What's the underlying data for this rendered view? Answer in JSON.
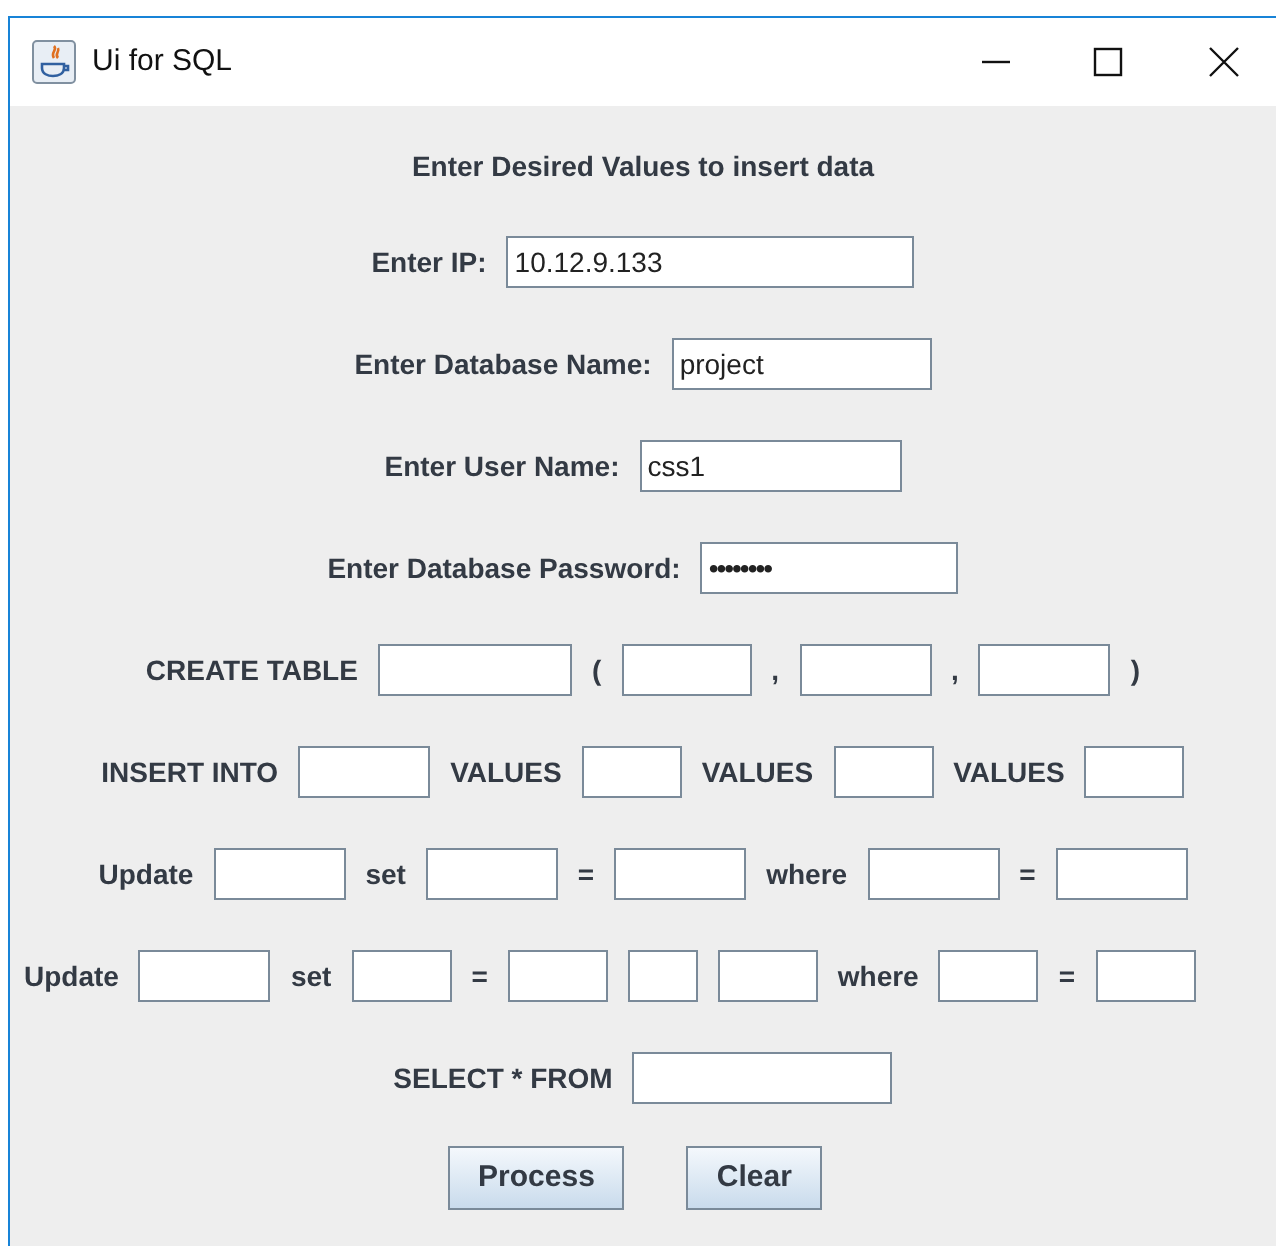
{
  "window": {
    "title": "Ui for SQL"
  },
  "heading": "Enter Desired Values to insert data",
  "rows": [
    {
      "items": [
        {
          "kind": "label",
          "text": "Enter IP:"
        },
        {
          "kind": "field",
          "value": "10.12.9.133"
        }
      ]
    },
    {
      "items": [
        {
          "kind": "label",
          "text": "Enter Database Name:"
        },
        {
          "kind": "field",
          "value": "project"
        }
      ]
    },
    {
      "items": [
        {
          "kind": "label",
          "text": "Enter User Name:"
        },
        {
          "kind": "field",
          "value": "css1"
        }
      ]
    },
    {
      "items": [
        {
          "kind": "label",
          "text": "Enter Database Password:"
        },
        {
          "kind": "password",
          "value": "••••••••"
        }
      ]
    },
    {
      "items": [
        {
          "kind": "label",
          "text": "CREATE TABLE"
        },
        {
          "kind": "field"
        },
        {
          "kind": "label",
          "text": "("
        },
        {
          "kind": "field"
        },
        {
          "kind": "label",
          "text": ","
        },
        {
          "kind": "field"
        },
        {
          "kind": "label",
          "text": ","
        },
        {
          "kind": "field"
        },
        {
          "kind": "label",
          "text": ")"
        }
      ]
    },
    {
      "items": [
        {
          "kind": "label",
          "text": "INSERT INTO"
        },
        {
          "kind": "field"
        },
        {
          "kind": "label",
          "text": "VALUES"
        },
        {
          "kind": "field"
        },
        {
          "kind": "label",
          "text": "VALUES"
        },
        {
          "kind": "field"
        },
        {
          "kind": "label",
          "text": "VALUES"
        },
        {
          "kind": "field"
        }
      ]
    },
    {
      "items": [
        {
          "kind": "label",
          "text": "Update"
        },
        {
          "kind": "field"
        },
        {
          "kind": "label",
          "text": "set"
        },
        {
          "kind": "field"
        },
        {
          "kind": "label",
          "text": "="
        },
        {
          "kind": "field"
        },
        {
          "kind": "label",
          "text": "where"
        },
        {
          "kind": "field"
        },
        {
          "kind": "label",
          "text": "="
        },
        {
          "kind": "field"
        }
      ]
    },
    {
      "items": [
        {
          "kind": "label",
          "text": "Update"
        },
        {
          "kind": "field"
        },
        {
          "kind": "label",
          "text": "set"
        },
        {
          "kind": "field"
        },
        {
          "kind": "label",
          "text": "="
        },
        {
          "kind": "field"
        },
        {
          "kind": "field"
        },
        {
          "kind": "field"
        },
        {
          "kind": "label",
          "text": "where"
        },
        {
          "kind": "field"
        },
        {
          "kind": "label",
          "text": "="
        },
        {
          "kind": "field"
        }
      ]
    },
    {
      "items": [
        {
          "kind": "label",
          "text": "SELECT * FROM"
        },
        {
          "kind": "field"
        }
      ]
    }
  ],
  "buttons": [
    "Process",
    "Clear"
  ]
}
